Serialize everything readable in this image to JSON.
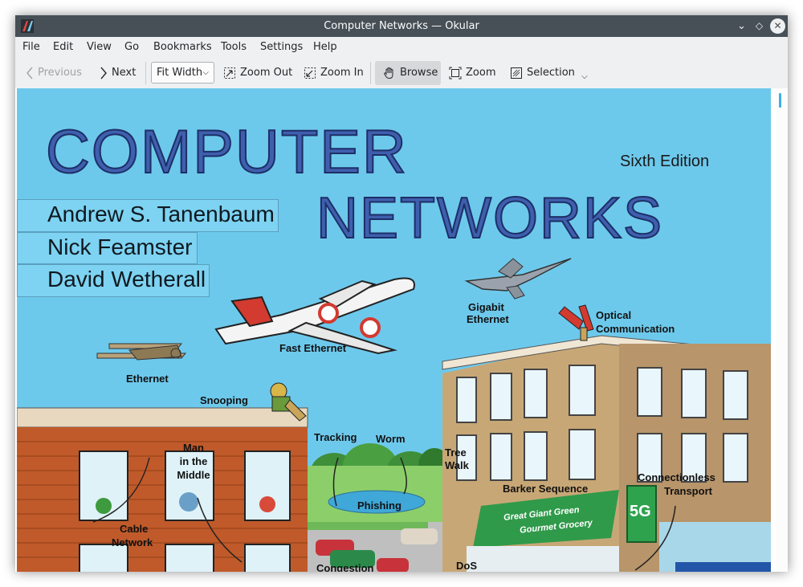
{
  "window": {
    "title": "Computer Networks — Okular",
    "controls": {
      "minimize": "⌄",
      "maximize": "◇",
      "close": "✕"
    }
  },
  "menu": [
    "File",
    "Edit",
    "View",
    "Go",
    "Bookmarks",
    "Tools",
    "Settings",
    "Help"
  ],
  "toolbar": {
    "previous": "Previous",
    "next": "Next",
    "zoom_mode": "Fit Width",
    "zoom_out": "Zoom Out",
    "zoom_in": "Zoom In",
    "browse": "Browse",
    "zoom": "Zoom",
    "selection": "Selection"
  },
  "colors": {
    "titlebar": "#475057",
    "window_bg": "#eff0f1",
    "cover_sky": "#6dc9ec",
    "accent": "#3daee9",
    "title_blue": "#3f5fae"
  },
  "cover": {
    "title_line1": "COMPUTER",
    "title_line2": "NETWORKS",
    "edition": "Sixth Edition",
    "authors": [
      "Andrew S. Tanenbaum",
      "Nick Feamster",
      "David Wetherall"
    ],
    "labels": {
      "fast_ethernet": "Fast Ethernet",
      "gigabit": "Gigabit",
      "ethernet_plane": "Ethernet",
      "ethernet": "Ethernet",
      "optical": "Optical",
      "communication": "Communication",
      "snooping": "Snooping",
      "man": "Man",
      "in_the": "in the",
      "middle": "Middle",
      "tracking": "Tracking",
      "worm": "Worm",
      "tree": "Tree",
      "walk": "Walk",
      "barker": "Barker Sequence",
      "connectionless": "Connectionless",
      "transport": "Transport",
      "phishing": "Phishing",
      "cable": "Cable",
      "network": "Network",
      "congestion": "Congestion",
      "dos": "DoS",
      "store_sign1": "Great Giant Green",
      "store_sign2": "Gourmet Grocery",
      "fiveg": "5G"
    }
  }
}
